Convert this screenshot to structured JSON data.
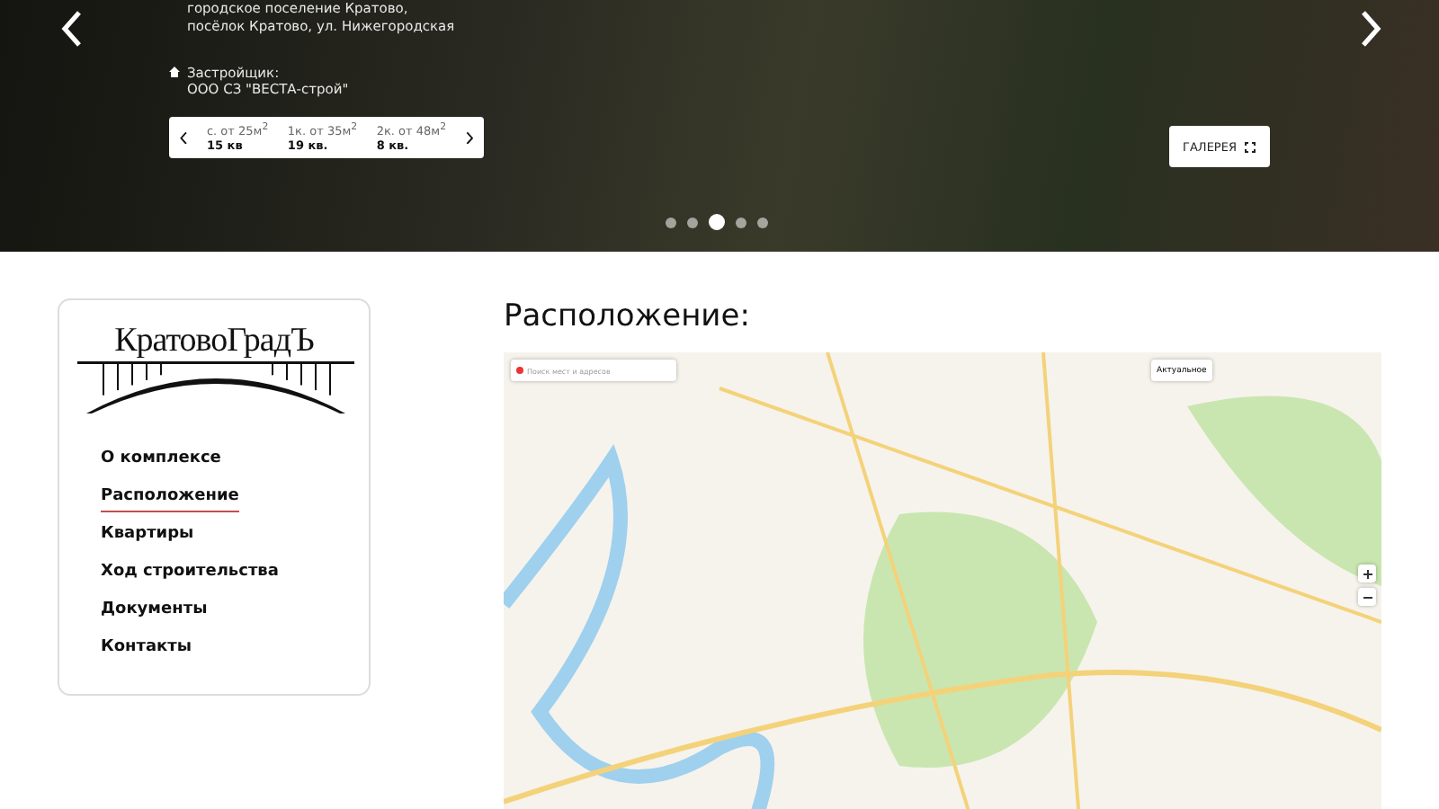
{
  "hero": {
    "address_lines": [
      "городское поселение Кратово,",
      "посёлок Кратово, ул. Нижегородская"
    ],
    "developer_label": "Застройщик:",
    "developer": "ООО СЗ \"ВЕСТА-строй\"",
    "offers": [
      {
        "type": "с. от 25м$^{2}$",
        "count": "15 кв"
      },
      {
        "type": "1к. от 35м$^{2}$",
        "count": "19 кв."
      },
      {
        "type": "2к. от 48м$^{2}$",
        "count": "8 кв."
      }
    ],
    "gallery_button": "ГАЛЕРЕЯ",
    "slides": [
      {
        "selected": false
      },
      {
        "selected": false
      },
      {
        "selected": true
      },
      {
        "selected": false
      },
      {
        "selected": false
      }
    ]
  },
  "sidebar": {
    "logo": "КратовоГрадЪ",
    "items": [
      {
        "label": "О комплексе",
        "selected": false
      },
      {
        "label": "Расположение",
        "selected": true
      },
      {
        "label": "Квартиры",
        "selected": false
      },
      {
        "label": "Ход строительства",
        "selected": false
      },
      {
        "label": "Документы",
        "selected": false
      },
      {
        "label": "Контакты",
        "selected": false
      }
    ]
  },
  "location": {
    "title": "Расположение:",
    "map_search_placeholder": "Поиск мест и адресов",
    "map_layer_button": "Актуальное"
  }
}
